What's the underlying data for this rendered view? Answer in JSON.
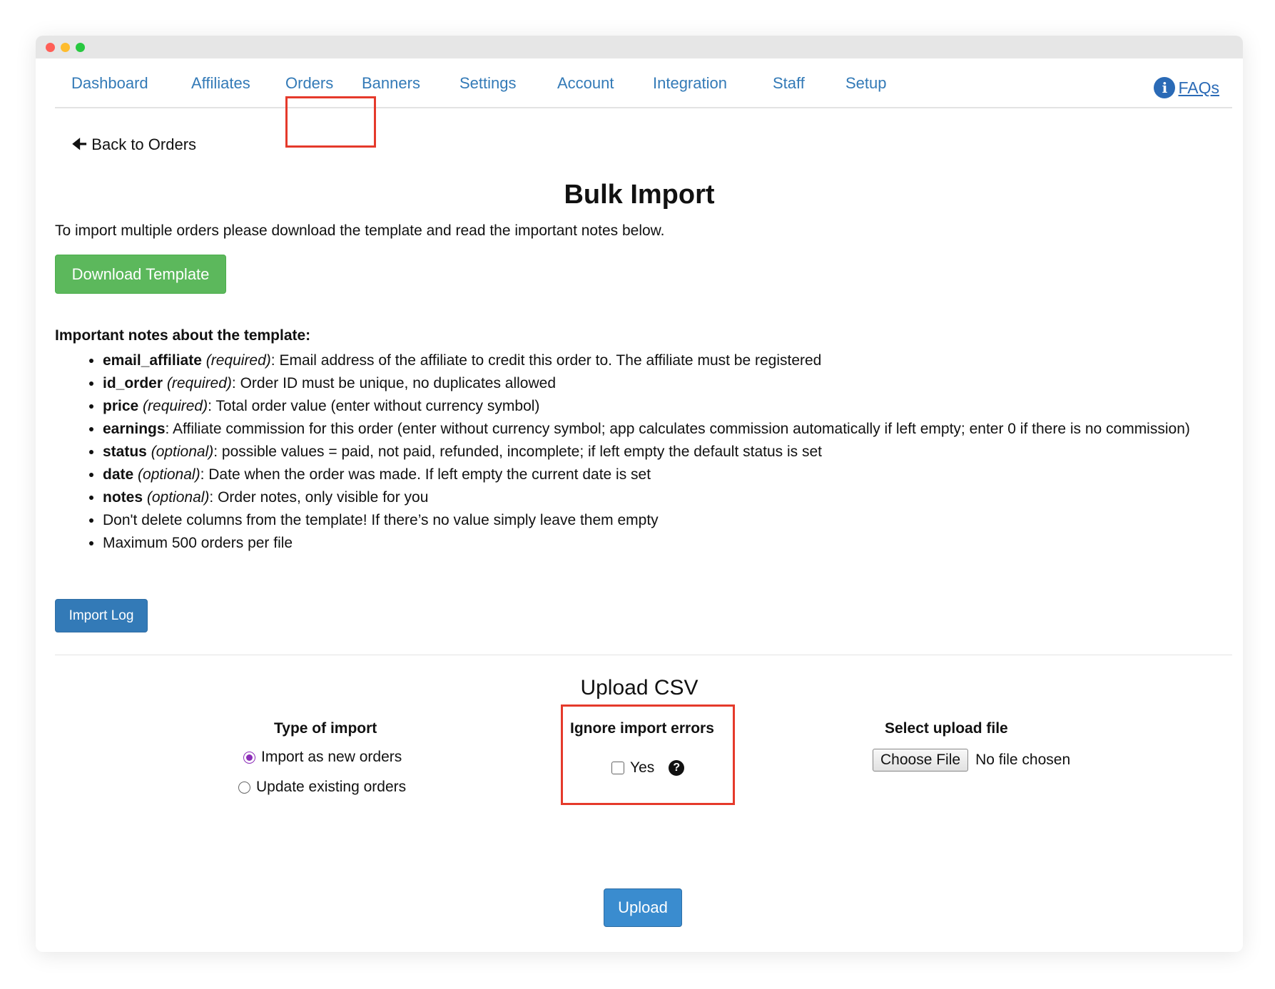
{
  "nav": {
    "tabs": [
      {
        "label": "Dashboard"
      },
      {
        "label": "Affiliates"
      },
      {
        "label": "Orders"
      },
      {
        "label": "Banners"
      },
      {
        "label": "Settings"
      },
      {
        "label": "Account"
      },
      {
        "label": "Integration"
      },
      {
        "label": "Staff"
      },
      {
        "label": "Setup"
      }
    ],
    "active_tab": "Orders",
    "faqs_label": " FAQs",
    "faqs_icon": "info-circle-icon"
  },
  "back_link": {
    "label": "Back to Orders",
    "icon": "arrow-left-icon"
  },
  "page": {
    "title": "Bulk Import",
    "intro": "To import multiple orders please download the template and read the important notes below.",
    "download_button": "Download Template",
    "notes_heading": "Important notes about the template:",
    "notes": [
      {
        "field": "email_affiliate",
        "qualifier": "(required)",
        "text": ": Email address of the affiliate to credit this order to. The affiliate must be registered"
      },
      {
        "field": "id_order",
        "qualifier": "(required)",
        "text": ": Order ID must be unique, no duplicates allowed"
      },
      {
        "field": "price",
        "qualifier": "(required)",
        "text": ": Total order value (enter without currency symbol)"
      },
      {
        "field": "earnings",
        "qualifier": "",
        "text": ": Affiliate commission for this order (enter without currency symbol; app calculates commission automatically if left empty; enter 0 if there is no commission)"
      },
      {
        "field": "status",
        "qualifier": "(optional)",
        "text": ": possible values = paid, not paid, refunded, incomplete; if left empty the default status is set"
      },
      {
        "field": "date",
        "qualifier": "(optional)",
        "text": ": Date when the order was made. If left empty the current date is set"
      },
      {
        "field": "notes",
        "qualifier": "(optional)",
        "text": ": Order notes, only visible for you"
      },
      {
        "field": "",
        "qualifier": "",
        "text": "Don't delete columns from the template! If there’s no value simply leave them empty"
      },
      {
        "field": "",
        "qualifier": "",
        "text": "Maximum 500 orders per file"
      }
    ],
    "import_log_button": "Import Log"
  },
  "upload": {
    "title": "Upload CSV",
    "type_heading": "Type of import",
    "options": [
      {
        "label": "Import as new orders",
        "checked": true
      },
      {
        "label": "Update existing orders",
        "checked": false
      }
    ],
    "ignore_heading": "Ignore import errors",
    "ignore_label": "Yes",
    "ignore_checked": false,
    "help_icon": "question-circle-icon",
    "file_heading": "Select upload file",
    "choose_file": "Choose File",
    "no_file": "No file chosen",
    "upload_button": "Upload"
  }
}
